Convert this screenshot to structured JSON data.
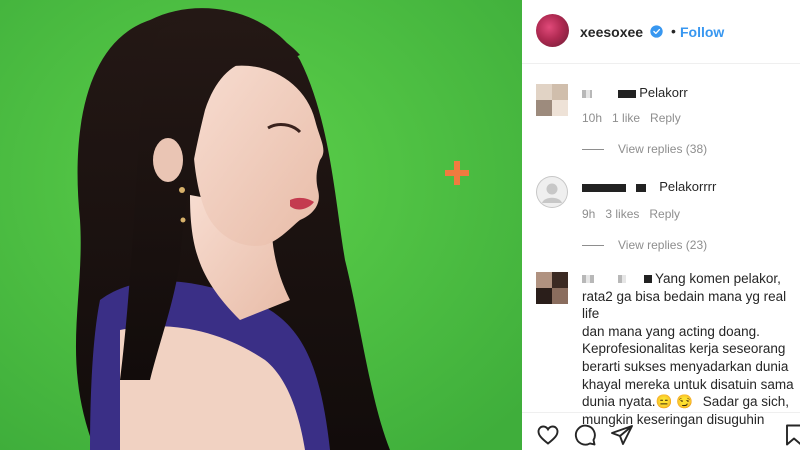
{
  "header": {
    "username": "xeesoxee",
    "separator": "•",
    "follow_label": "Follow",
    "verified_icon": "verified-badge-icon",
    "accent_color": "#3897f0"
  },
  "photo": {
    "background_color": "#4fc243",
    "marker_icon": "plus-marker-icon",
    "marker_color": "#f07b3f"
  },
  "comments": [
    {
      "text": "Pelakorr",
      "time": "10h",
      "likes": "1 like",
      "reply_label": "Reply",
      "view_replies": "View replies (38)"
    },
    {
      "text": "Pelakorrrr",
      "time": "9h",
      "likes": "3 likes",
      "reply_label": "Reply",
      "view_replies": "View replies (23)"
    },
    {
      "line1": "Yang komen pelakor,",
      "line2": "rata2 ga bisa bedain mana yg real life",
      "line3": "dan mana yang acting doang.",
      "line4": "Keprofesionalitas kerja seseorang",
      "line5": "berarti sukses menyadarkan dunia",
      "line6": "khayal mereka untuk disatuin sama",
      "line7": "dunia nyata.",
      "line7_emoji": "😑 😏",
      "line7_tail": "Sadar ga sich,",
      "line8": "mungkin keseringan disuguhin"
    }
  ],
  "actions": {
    "like_icon": "heart-icon",
    "comment_icon": "comment-icon",
    "share_icon": "share-icon",
    "save_icon": "bookmark-icon"
  }
}
